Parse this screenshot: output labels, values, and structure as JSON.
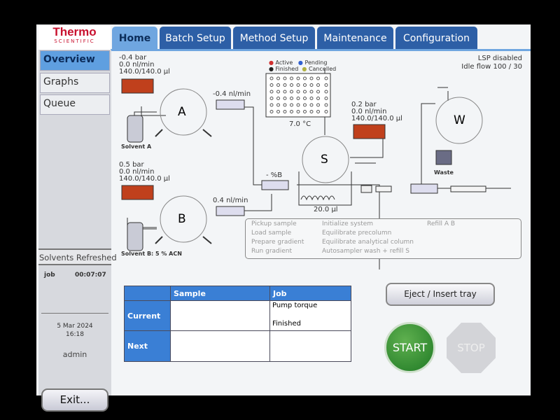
{
  "logo": {
    "brand": "Thermo",
    "sub": "SCIENTIFIC"
  },
  "tabs": [
    "Home",
    "Batch Setup",
    "Method Setup",
    "Maintenance",
    "Configuration"
  ],
  "sidebar": {
    "items": [
      "Overview",
      "Graphs",
      "Queue"
    ],
    "status": "Solvents Refreshed",
    "job_label": "job",
    "job_time": "00:07:07",
    "date": "5 Mar 2024",
    "time": "16:18",
    "user": "admin",
    "exit": "Exit..."
  },
  "status": {
    "lsp": "LSP disabled",
    "idle_flow": "Idle flow 100 / 30"
  },
  "pump_a": {
    "pressure": "-0.4 bar",
    "flow": "0.0 nl/min",
    "volume": "140.0/140.0 µl",
    "valve": "A",
    "solvent": "Solvent A",
    "flow_sensor": "-0.4 nl/min"
  },
  "pump_b": {
    "pressure": "0.5 bar",
    "flow": "0.0 nl/min",
    "volume": "140.0/140.0 µl",
    "valve": "B",
    "solvent": "Solvent B: 5 % ACN",
    "flow_sensor": "0.4 nl/min"
  },
  "pump_s": {
    "pressure": "0.2 bar",
    "flow": "0.0 nl/min",
    "volume": "140.0/140.0 µl",
    "valve": "S",
    "loop": "20.0 µl"
  },
  "mixer": "- %B",
  "tray": {
    "temp": "7.0 °C",
    "legend": [
      {
        "label": "Active",
        "color": "#d03030"
      },
      {
        "label": "Pending",
        "color": "#3060d0"
      },
      {
        "label": "Finished",
        "color": "#222222"
      },
      {
        "label": "Cancelled",
        "color": "#b0b040"
      }
    ]
  },
  "waste": {
    "valve": "W",
    "label": "Waste"
  },
  "operations": [
    "Pickup sample",
    "Load sample",
    "Prepare gradient",
    "Run gradient",
    "Initialize system",
    "Equilibrate precolumn",
    "Equilibrate analytical column",
    "Autosampler wash + refill S",
    "Refill  A B"
  ],
  "table": {
    "headers": [
      "",
      "Sample",
      "Job"
    ],
    "rows": [
      {
        "label": "Current",
        "sample": "",
        "job": "Pump torque",
        "job2": "Finished"
      },
      {
        "label": "Next",
        "sample": "",
        "job": ""
      }
    ]
  },
  "buttons": {
    "eject": "Eject / Insert tray",
    "start": "START",
    "stop": "STOP"
  },
  "colors": {
    "tab": "#2d5fa6",
    "active": "#6fa6e0",
    "start": "#1f7a25",
    "pump": "#c0401c"
  }
}
